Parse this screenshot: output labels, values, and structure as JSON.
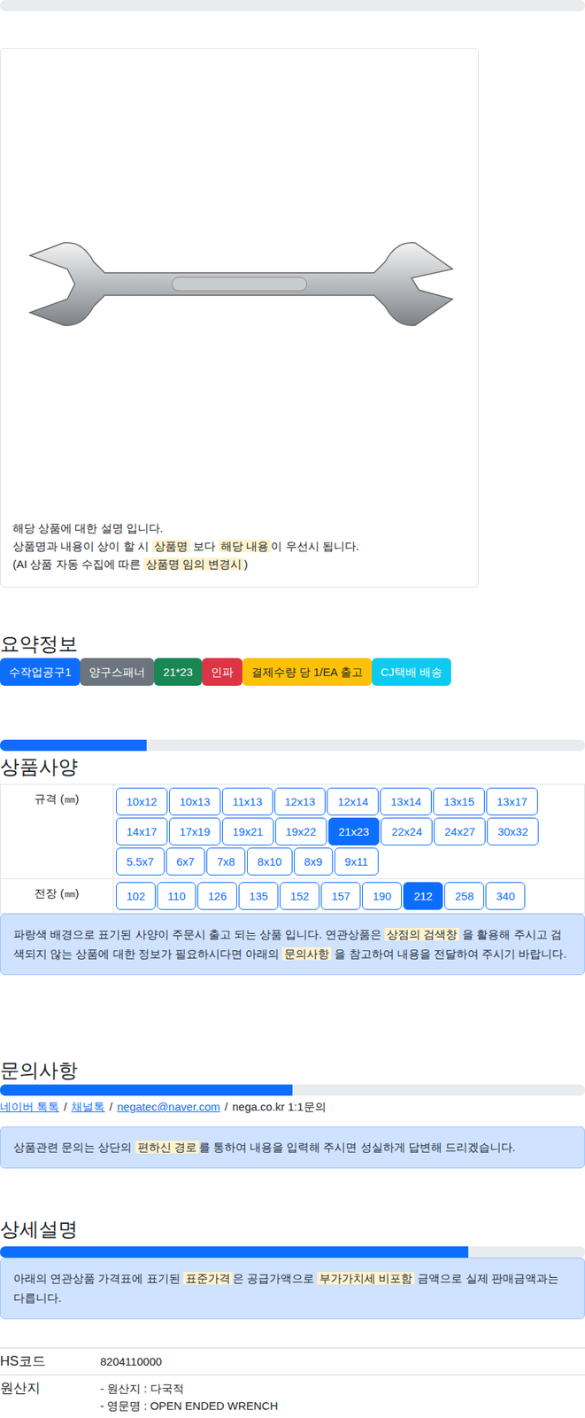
{
  "photo": {
    "caption": [
      [
        {
          "text": "해당 상품에 대한 설명 입니다.",
          "highlight": false
        }
      ],
      [
        {
          "text": "상품명과 내용이 상이 할 시 ",
          "highlight": false
        },
        {
          "text": "상품명",
          "highlight": true
        },
        {
          "text": " 보다 ",
          "highlight": false
        },
        {
          "text": "해당 내용",
          "highlight": true
        },
        {
          "text": "이 우선시 됩니다.",
          "highlight": false
        }
      ],
      [
        {
          "text": "(AI 상품 자동 수집에 따른 ",
          "highlight": false
        },
        {
          "text": "상품명 임의 변경시",
          "highlight": true
        },
        {
          "text": ")",
          "highlight": false
        }
      ]
    ]
  },
  "summary": {
    "title": "요약정보",
    "tags": [
      {
        "text": "수작업공구1",
        "color": "#0d6efd"
      },
      {
        "text": "양구스패너",
        "color": "#6c757d"
      },
      {
        "text": "21*23",
        "color": "#198754"
      },
      {
        "text": "인파",
        "color": "#dc3545"
      },
      {
        "text": "결제수량 당 1/EA 출고",
        "color": "#ffc107"
      },
      {
        "text": "CJ택배 배송",
        "color": "#0dcaf0"
      }
    ]
  },
  "spec": {
    "title": "상품사양",
    "level": 0.25,
    "rows": [
      {
        "label": "규격 (㎜)",
        "options": [
          {
            "text": "10x12",
            "selected": false
          },
          {
            "text": "10x13",
            "selected": false
          },
          {
            "text": "11x13",
            "selected": false
          },
          {
            "text": "12x13",
            "selected": false
          },
          {
            "text": "12x14",
            "selected": false
          },
          {
            "text": "13x14",
            "selected": false
          },
          {
            "text": "13x15",
            "selected": false
          },
          {
            "text": "13x17",
            "selected": false
          },
          {
            "text": "14x17",
            "selected": false
          },
          {
            "text": "17x19",
            "selected": false
          },
          {
            "text": "19x21",
            "selected": false
          },
          {
            "text": "19x22",
            "selected": false
          },
          {
            "text": "21x23",
            "selected": true
          },
          {
            "text": "22x24",
            "selected": false
          },
          {
            "text": "24x27",
            "selected": false
          },
          {
            "text": "30x32",
            "selected": false
          },
          {
            "text": "5.5x7",
            "selected": false
          },
          {
            "text": "6x7",
            "selected": false
          },
          {
            "text": "7x8",
            "selected": false
          },
          {
            "text": "8x10",
            "selected": false
          },
          {
            "text": "8x9",
            "selected": false
          },
          {
            "text": "9x11",
            "selected": false
          }
        ]
      },
      {
        "label": "전장 (㎜)",
        "options": [
          {
            "text": "102",
            "selected": false
          },
          {
            "text": "110",
            "selected": false
          },
          {
            "text": "126",
            "selected": false
          },
          {
            "text": "135",
            "selected": false
          },
          {
            "text": "152",
            "selected": false
          },
          {
            "text": "157",
            "selected": false
          },
          {
            "text": "190",
            "selected": false
          },
          {
            "text": "212",
            "selected": true
          },
          {
            "text": "258",
            "selected": false
          },
          {
            "text": "340",
            "selected": false
          }
        ]
      }
    ],
    "notice": [
      {
        "text": "파랑색 배경으로 표기된 사양이 주문시 출고 되는 상품 입니다. 연관상품은 ",
        "highlight": false
      },
      {
        "text": "상점의 검색창",
        "highlight": true
      },
      {
        "text": " 을 활용해 주시고 검색되지 않는 상품에 대한 정보가 필요하시다면 아래의 ",
        "highlight": false
      },
      {
        "text": "문의사항",
        "highlight": true
      },
      {
        "text": " 을 참고하여 내용을 전달하여 주시기 바랍니다.",
        "highlight": false
      }
    ]
  },
  "inquiry": {
    "title": "문의사항",
    "level": 0.5,
    "contacts": [
      {
        "text": "네이버 톡톡",
        "kind": "link"
      },
      {
        "text": "/",
        "kind": "separator"
      },
      {
        "text": "채널톡",
        "kind": "link"
      },
      {
        "text": "/",
        "kind": "separator"
      },
      {
        "text": "negatec@naver.com",
        "kind": "link"
      },
      {
        "text": "/",
        "kind": "separator"
      },
      {
        "text": "nega.co.kr 1:1문의",
        "kind": "plain"
      }
    ],
    "notice": [
      {
        "text": "상품관련 문의는 상단의 ",
        "highlight": false
      },
      {
        "text": "편하신 경로",
        "highlight": true
      },
      {
        "text": "를 통하여 내용을 입력해 주시면 성실하게 답변해 드리겠습니다.",
        "highlight": false
      }
    ]
  },
  "detail": {
    "title": "상세설명",
    "level": 0.8,
    "notice": [
      {
        "text": "아래의 연관상품 가격표에 표기된 ",
        "highlight": false
      },
      {
        "text": "표준가격",
        "highlight": true
      },
      {
        "text": "은 공급가액으로 ",
        "highlight": false
      },
      {
        "text": "부가가치세 비포함",
        "highlight": true
      },
      {
        "text": " 금액으로 실제 판매금액과는 다릅니다.",
        "highlight": false
      }
    ],
    "info": [
      {
        "label": "HS코드",
        "values": [
          "8204110000"
        ]
      },
      {
        "label": "원산지",
        "values": [
          "- 원산지 : 다국적",
          "- 영문명 : OPEN ENDED WRENCH"
        ]
      }
    ]
  }
}
